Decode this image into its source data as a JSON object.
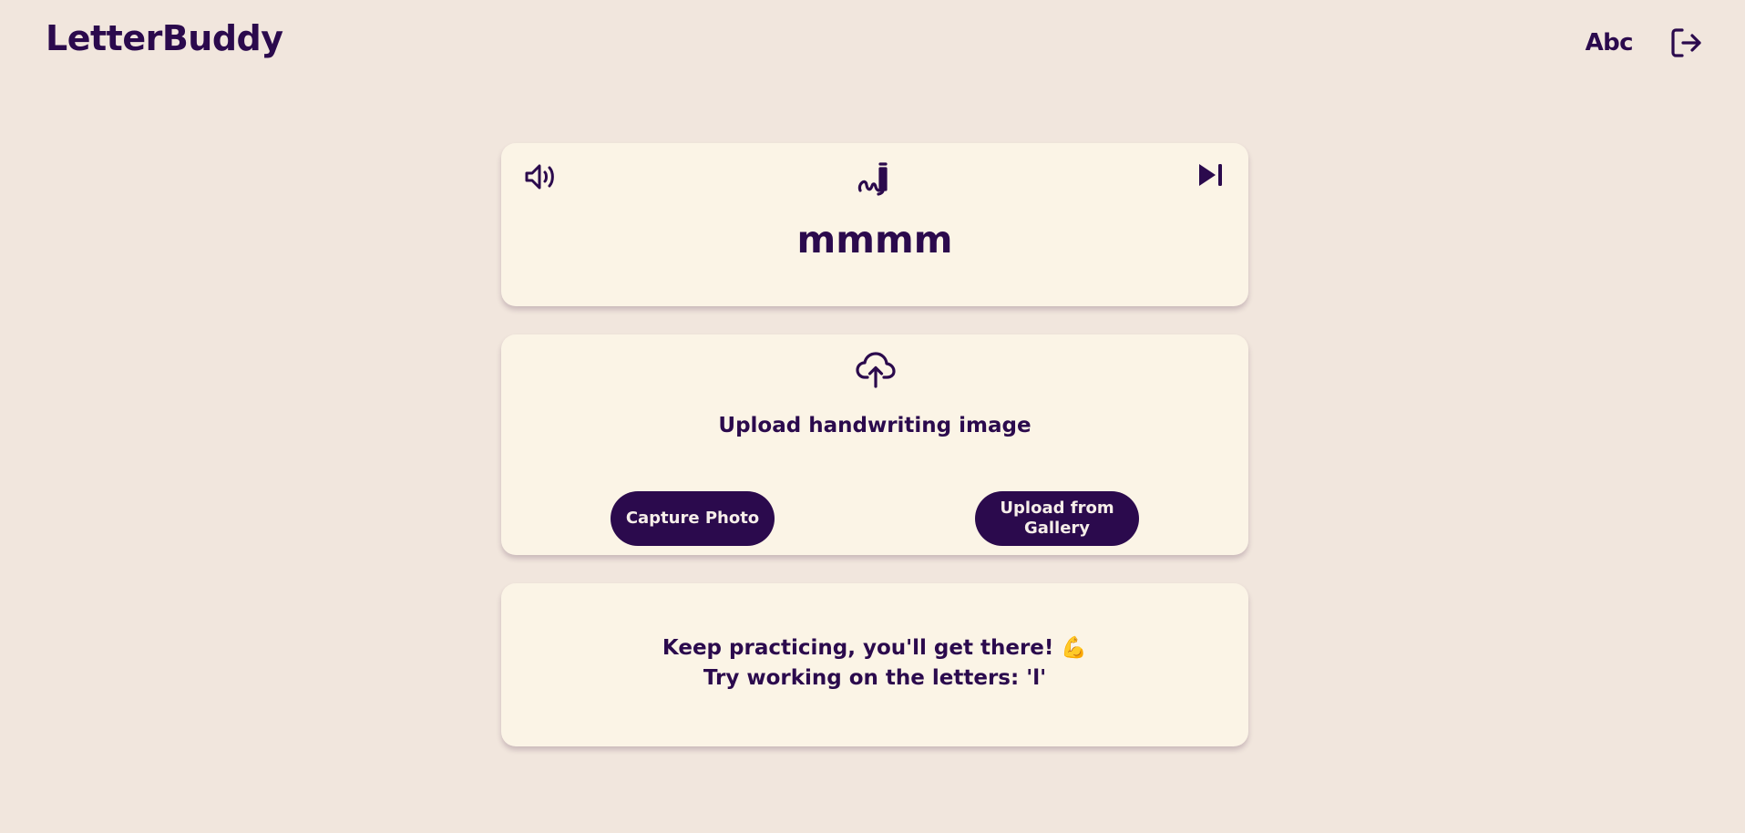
{
  "header": {
    "brand": "LetterBuddy",
    "alphabet_label": "Abc"
  },
  "word_card": {
    "word": "mmmm"
  },
  "upload_card": {
    "title": "Upload handwriting image",
    "capture_label": "Capture Photo",
    "gallery_label": "Upload from Gallery"
  },
  "feedback_card": {
    "line1": "Keep practicing, you'll get there!",
    "line1_emoji": "💪",
    "line2": "Try working on the letters: 'l'"
  },
  "icons": {
    "speaker": "speaker-icon",
    "write": "handwriting-icon",
    "next": "skip-next-icon",
    "upload": "cloud-upload-icon",
    "logout": "logout-icon"
  },
  "colors": {
    "background": "#f1e6dd",
    "card": "#fbf4e6",
    "primary": "#2b0a4d",
    "button_text": "#f6eee9"
  }
}
